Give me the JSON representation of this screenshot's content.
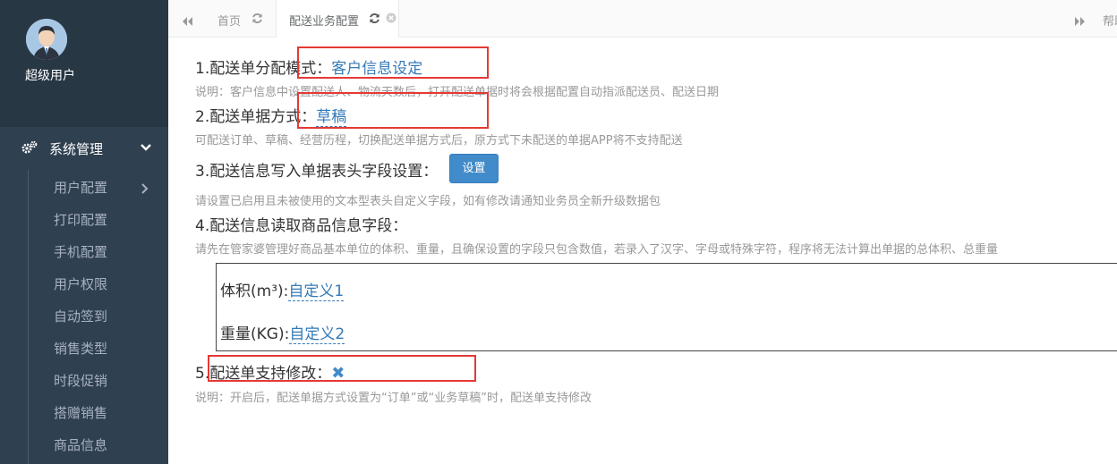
{
  "sidebar": {
    "username": "超级用户",
    "menu_title": "系统管理",
    "items": [
      {
        "label": "用户配置"
      },
      {
        "label": "打印配置"
      },
      {
        "label": "手机配置"
      },
      {
        "label": "用户权限"
      },
      {
        "label": "自动签到"
      },
      {
        "label": "销售类型"
      },
      {
        "label": "时段促销"
      },
      {
        "label": "搭赠销售"
      },
      {
        "label": "商品信息"
      }
    ]
  },
  "tabs": {
    "home": "首页",
    "active": "配送业务配置",
    "help": "帮助"
  },
  "settings": {
    "s1_title": "1.配送单分配模式：",
    "s1_value": "客户信息设定",
    "s1_desc": "说明：客户信息中设置配送人、物流天数后，打开配送单据时将会根据配置自动指派配送员、配送日期",
    "s2_title": "2.配送单据方式：",
    "s2_value": "草稿",
    "s2_desc": "可配送订单、草稿、经营历程，切换配送单据方式后，原方式下未配送的单据APP将不支持配送",
    "s3_title": "3.配送信息写入单据表头字段设置：",
    "s3_button": "设置",
    "s3_desc": "请设置已启用且未被使用的文本型表头自定义字段，如有修改请通知业务员全新升级数据包",
    "s4_title": "4.配送信息读取商品信息字段：",
    "s4_desc": "请先在管家婆管理好商品基本单位的体积、重量，且确保设置的字段只包含数值，若录入了汉字、字母或特殊字符，程序将无法计算出单据的总体积、总重量",
    "volume_label": "体积(m³):",
    "volume_value": "自定义1",
    "weight_label": "重量(KG):",
    "weight_value": "自定义2",
    "s5_title": "5.配送单支持修改：",
    "s5_value": "✖",
    "s5_desc": "说明：开启后，配送单据方式设置为“订单”或“业务草稿”时，配送单支持修改"
  },
  "colors": {
    "sidebar_bg": "#2f4050",
    "profile_bg": "#283744",
    "link": "#337ab7",
    "button": "#428bca",
    "highlight": "#e53935"
  }
}
